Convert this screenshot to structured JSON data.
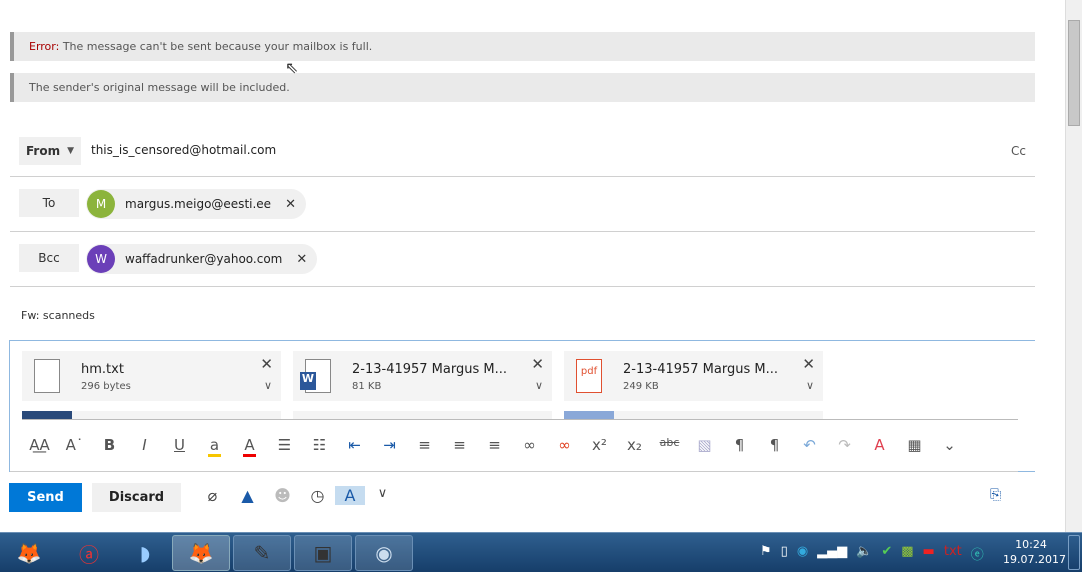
{
  "notifications": {
    "error_label": "Error:",
    "error_text": " The message can't be sent because your mailbox is full.",
    "info_text": "The sender's original message will be included."
  },
  "from": {
    "label": "From",
    "value": "this_is_censored@hotmail.com",
    "cc": "Cc"
  },
  "to": {
    "label": "To",
    "recipients": [
      {
        "initial": "M",
        "email": "margus.meigo@eesti.ee",
        "color": "#8cb43c"
      }
    ]
  },
  "bcc": {
    "label": "Bcc",
    "recipients": [
      {
        "initial": "W",
        "email": "waffadrunker@yahoo.com",
        "color": "#6b3fb8"
      }
    ]
  },
  "subject": "Fw: scanneds",
  "attachments": [
    {
      "name": "hm.txt",
      "size": "296 bytes",
      "type": "txt"
    },
    {
      "name": "2-13-41957 Margus M...",
      "size": "81 KB",
      "type": "word"
    },
    {
      "name": "2-13-41957 Margus M...",
      "size": "249 KB",
      "type": "pdf",
      "badge": "pdf"
    }
  ],
  "actions": {
    "send": "Send",
    "discard": "Discard"
  },
  "taskbar": {
    "time": "10:24",
    "date": "19.07.2017"
  },
  "colors": {
    "accent": "#0078d7"
  }
}
